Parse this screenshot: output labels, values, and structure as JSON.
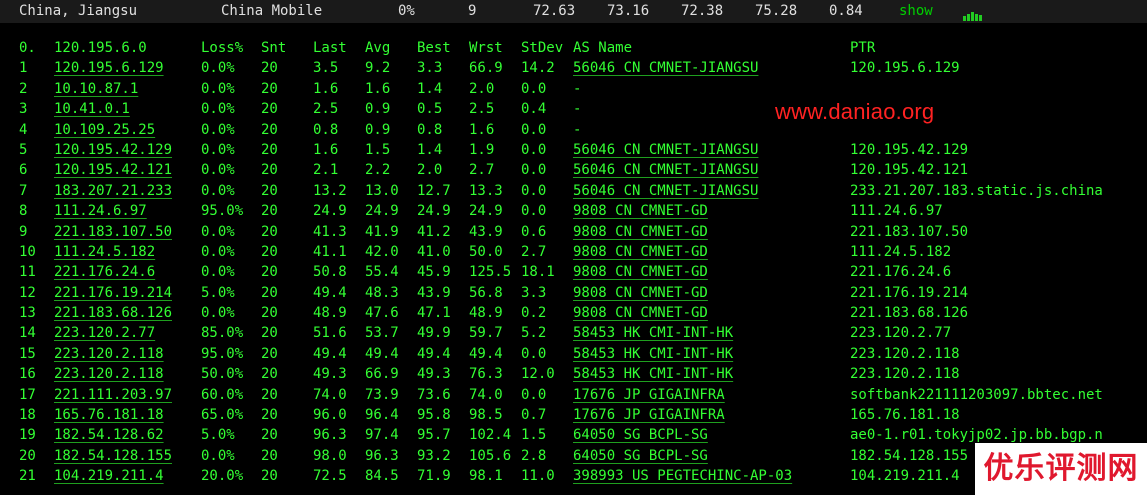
{
  "summary": {
    "region": "China, Jiangsu",
    "carrier": "China Mobile",
    "loss": "0%",
    "count": "9",
    "v1": "72.63",
    "v2": "73.16",
    "v3": "72.38",
    "v4": "75.28",
    "v5": "0.84",
    "show_label": "show"
  },
  "headers": {
    "hop": "0.",
    "ip": "120.195.6.0",
    "loss": "Loss%",
    "snt": "Snt",
    "last": "Last",
    "avg": "Avg",
    "best": "Best",
    "wrst": "Wrst",
    "stdev": "StDev",
    "as": "AS Name",
    "ptr": "PTR"
  },
  "hops": [
    {
      "hop": "1",
      "ip": "120.195.6.129",
      "loss": "0.0%",
      "snt": "20",
      "last": "3.5",
      "avg": "9.2",
      "best": "3.3",
      "wrst": "66.9",
      "stdev": "14.2",
      "as": "56046 CN CMNET-JIANGSU",
      "ptr": "120.195.6.129"
    },
    {
      "hop": "2",
      "ip": "10.10.87.1",
      "loss": "0.0%",
      "snt": "20",
      "last": "1.6",
      "avg": "1.6",
      "best": "1.4",
      "wrst": "2.0",
      "stdev": "0.0",
      "as": "-",
      "ptr": ""
    },
    {
      "hop": "3",
      "ip": "10.41.0.1",
      "loss": "0.0%",
      "snt": "20",
      "last": "2.5",
      "avg": "0.9",
      "best": "0.5",
      "wrst": "2.5",
      "stdev": "0.4",
      "as": "-",
      "ptr": ""
    },
    {
      "hop": "4",
      "ip": "10.109.25.25",
      "loss": "0.0%",
      "snt": "20",
      "last": "0.8",
      "avg": "0.9",
      "best": "0.8",
      "wrst": "1.6",
      "stdev": "0.0",
      "as": "-",
      "ptr": ""
    },
    {
      "hop": "5",
      "ip": "120.195.42.129",
      "loss": "0.0%",
      "snt": "20",
      "last": "1.6",
      "avg": "1.5",
      "best": "1.4",
      "wrst": "1.9",
      "stdev": "0.0",
      "as": "56046 CN CMNET-JIANGSU",
      "ptr": "120.195.42.129"
    },
    {
      "hop": "6",
      "ip": "120.195.42.121",
      "loss": "0.0%",
      "snt": "20",
      "last": "2.1",
      "avg": "2.2",
      "best": "2.0",
      "wrst": "2.7",
      "stdev": "0.0",
      "as": "56046 CN CMNET-JIANGSU",
      "ptr": "120.195.42.121"
    },
    {
      "hop": "7",
      "ip": "183.207.21.233",
      "loss": "0.0%",
      "snt": "20",
      "last": "13.2",
      "avg": "13.0",
      "best": "12.7",
      "wrst": "13.3",
      "stdev": "0.0",
      "as": "56046 CN CMNET-JIANGSU",
      "ptr": "233.21.207.183.static.js.china"
    },
    {
      "hop": "8",
      "ip": "111.24.6.97",
      "loss": "95.0%",
      "snt": "20",
      "last": "24.9",
      "avg": "24.9",
      "best": "24.9",
      "wrst": "24.9",
      "stdev": "0.0",
      "as": "9808  CN CMNET-GD",
      "ptr": "111.24.6.97"
    },
    {
      "hop": "9",
      "ip": "221.183.107.50",
      "loss": "0.0%",
      "snt": "20",
      "last": "41.3",
      "avg": "41.9",
      "best": "41.2",
      "wrst": "43.9",
      "stdev": "0.6",
      "as": "9808  CN CMNET-GD",
      "ptr": "221.183.107.50"
    },
    {
      "hop": "10",
      "ip": "111.24.5.182",
      "loss": "0.0%",
      "snt": "20",
      "last": "41.1",
      "avg": "42.0",
      "best": "41.0",
      "wrst": "50.0",
      "stdev": "2.7",
      "as": "9808  CN CMNET-GD",
      "ptr": "111.24.5.182"
    },
    {
      "hop": "11",
      "ip": "221.176.24.6",
      "loss": "0.0%",
      "snt": "20",
      "last": "50.8",
      "avg": "55.4",
      "best": "45.9",
      "wrst": "125.5",
      "stdev": "18.1",
      "as": "9808  CN CMNET-GD",
      "ptr": "221.176.24.6"
    },
    {
      "hop": "12",
      "ip": "221.176.19.214",
      "loss": "5.0%",
      "snt": "20",
      "last": "49.4",
      "avg": "48.3",
      "best": "43.9",
      "wrst": "56.8",
      "stdev": "3.3",
      "as": "9808  CN CMNET-GD",
      "ptr": "221.176.19.214"
    },
    {
      "hop": "13",
      "ip": "221.183.68.126",
      "loss": "0.0%",
      "snt": "20",
      "last": "48.9",
      "avg": "47.6",
      "best": "47.1",
      "wrst": "48.9",
      "stdev": "0.2",
      "as": "9808  CN CMNET-GD",
      "ptr": "221.183.68.126"
    },
    {
      "hop": "14",
      "ip": "223.120.2.77",
      "loss": "85.0%",
      "snt": "20",
      "last": "51.6",
      "avg": "53.7",
      "best": "49.9",
      "wrst": "59.7",
      "stdev": "5.2",
      "as": "58453 HK CMI-INT-HK",
      "ptr": "223.120.2.77"
    },
    {
      "hop": "15",
      "ip": "223.120.2.118",
      "loss": "95.0%",
      "snt": "20",
      "last": "49.4",
      "avg": "49.4",
      "best": "49.4",
      "wrst": "49.4",
      "stdev": "0.0",
      "as": "58453 HK CMI-INT-HK",
      "ptr": "223.120.2.118"
    },
    {
      "hop": "16",
      "ip": "223.120.2.118",
      "loss": "50.0%",
      "snt": "20",
      "last": "49.3",
      "avg": "66.9",
      "best": "49.3",
      "wrst": "76.3",
      "stdev": "12.0",
      "as": "58453 HK CMI-INT-HK",
      "ptr": "223.120.2.118"
    },
    {
      "hop": "17",
      "ip": "221.111.203.97",
      "loss": "60.0%",
      "snt": "20",
      "last": "74.0",
      "avg": "73.9",
      "best": "73.6",
      "wrst": "74.0",
      "stdev": "0.0",
      "as": "17676 JP GIGAINFRA",
      "ptr": "softbank221111203097.bbtec.net"
    },
    {
      "hop": "18",
      "ip": "165.76.181.18",
      "loss": "65.0%",
      "snt": "20",
      "last": "96.0",
      "avg": "96.4",
      "best": "95.8",
      "wrst": "98.5",
      "stdev": "0.7",
      "as": "17676 JP GIGAINFRA",
      "ptr": "165.76.181.18"
    },
    {
      "hop": "19",
      "ip": "182.54.128.62",
      "loss": "5.0%",
      "snt": "20",
      "last": "96.3",
      "avg": "97.4",
      "best": "95.7",
      "wrst": "102.4",
      "stdev": "1.5",
      "as": "64050 SG BCPL-SG",
      "ptr": "ae0-1.r01.tokyjp02.jp.bb.bgp.n"
    },
    {
      "hop": "20",
      "ip": "182.54.128.155",
      "loss": "0.0%",
      "snt": "20",
      "last": "98.0",
      "avg": "96.3",
      "best": "93.2",
      "wrst": "105.6",
      "stdev": "2.8",
      "as": "64050 SG BCPL-SG",
      "ptr": "182.54.128.155"
    },
    {
      "hop": "21",
      "ip": "104.219.211.4",
      "loss": "20.0%",
      "snt": "20",
      "last": "72.5",
      "avg": "84.5",
      "best": "71.9",
      "wrst": "98.1",
      "stdev": "11.0",
      "as": "398993 US PEGTECHINC-AP-03",
      "ptr": "104.219.211.4"
    }
  ],
  "watermark": {
    "url": "www.daniao.org",
    "logo_text": "优乐评测网"
  },
  "colors": {
    "background": "#000000",
    "text_green": "#33ff33",
    "summary_bg": "#1a1a1a",
    "watermark_red": "#ff2222"
  }
}
